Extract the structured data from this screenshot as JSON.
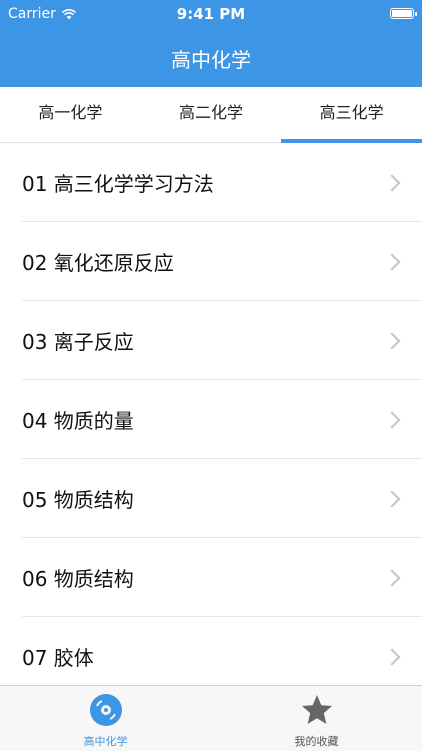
{
  "status_bar": {
    "carrier": "Carrier",
    "time": "9:41 PM",
    "icons": [
      "wifi-icon",
      "battery-icon"
    ]
  },
  "nav": {
    "title": "高中化学"
  },
  "tabs": [
    {
      "label": "高一化学",
      "active": false
    },
    {
      "label": "高二化学",
      "active": false
    },
    {
      "label": "高三化学",
      "active": true
    }
  ],
  "list": {
    "items": [
      {
        "label": "01 高三化学学习方法"
      },
      {
        "label": "02 氧化还原反应"
      },
      {
        "label": "03 离子反应"
      },
      {
        "label": "04 物质的量"
      },
      {
        "label": "05 物质结构"
      },
      {
        "label": "06 物质结构"
      },
      {
        "label": "07 胶体"
      }
    ]
  },
  "tabbar": {
    "items": [
      {
        "label": "高中化学",
        "icon": "disc-icon",
        "active": true
      },
      {
        "label": "我的收藏",
        "icon": "star-icon",
        "active": false
      }
    ]
  },
  "colors": {
    "accent": "#3d95e6",
    "inactive": "#555555",
    "separator": "#e6e6e6"
  }
}
